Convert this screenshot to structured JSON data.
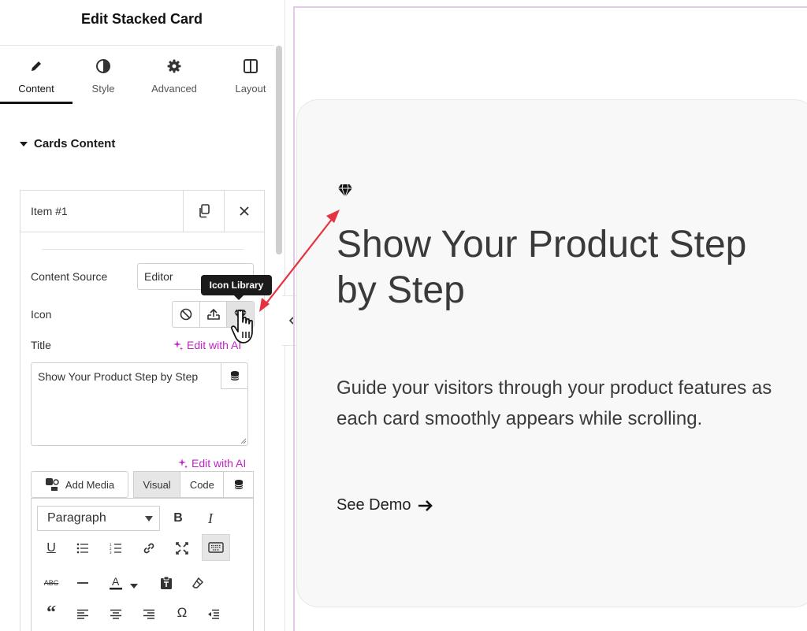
{
  "panel": {
    "title": "Edit Stacked Card",
    "tabs": [
      {
        "label": "Content",
        "icon": "pencil-icon"
      },
      {
        "label": "Style",
        "icon": "contrast-icon"
      },
      {
        "label": "Advanced",
        "icon": "gear-icon"
      },
      {
        "label": "Layout",
        "icon": "columns-icon"
      }
    ],
    "active_tab": "Content",
    "section": "Cards Content",
    "item": {
      "title": "Item #1",
      "content_source_label": "Content Source",
      "content_source_value": "Editor",
      "icon_label": "Icon",
      "title_label": "Title",
      "edit_ai_label": "Edit with AI",
      "title_value": "Show Your Product Step by Step",
      "add_media_label": "Add Media",
      "mode_visual": "Visual",
      "mode_code": "Code",
      "format_value": "Paragraph"
    },
    "tooltip": "Icon Library"
  },
  "card": {
    "title": "Show Your Product Step by Step",
    "description": "Guide your visitors through your product features as each card smoothly appears while scrolling.",
    "link_label": "See Demo"
  },
  "colors": {
    "ai_accent": "#c025c4",
    "arrow": "#e5333f",
    "canvas_outline": "#e6c7ea"
  }
}
